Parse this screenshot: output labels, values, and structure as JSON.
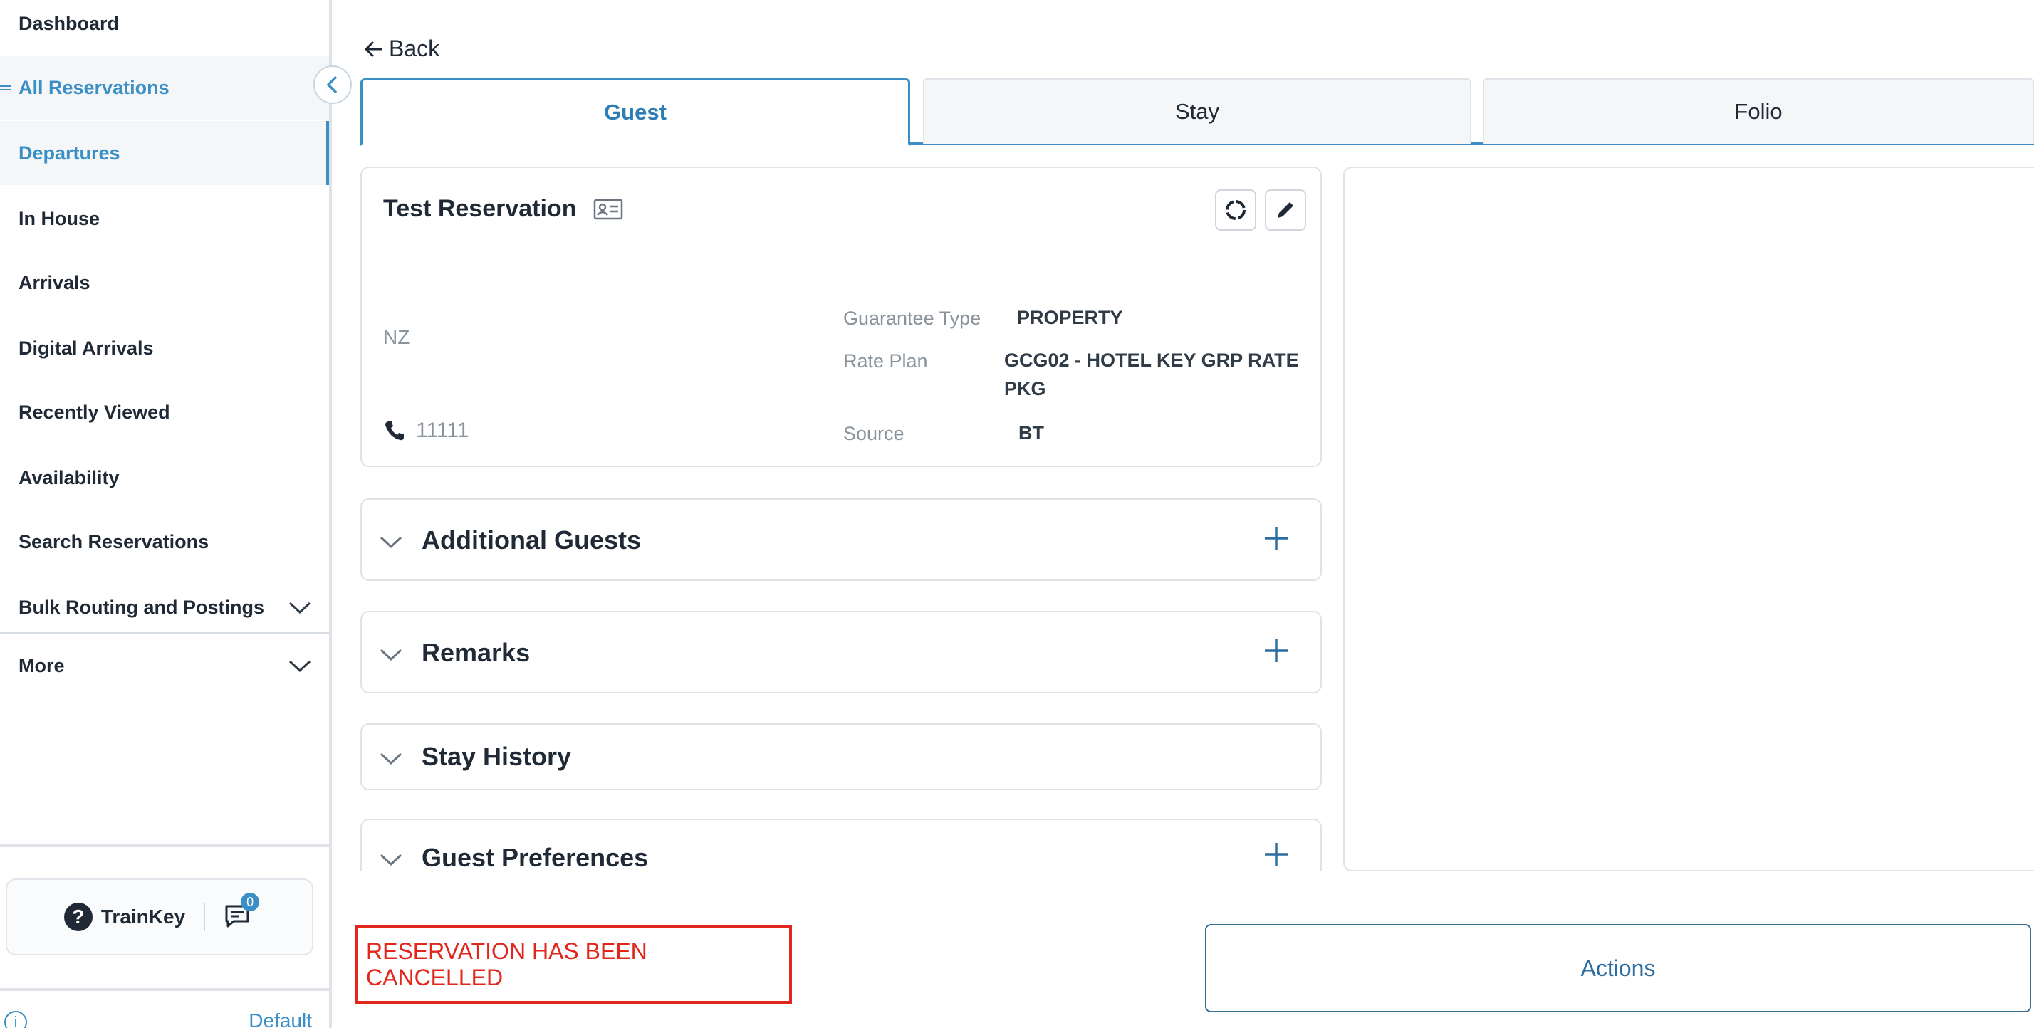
{
  "sidebar": {
    "items": [
      {
        "label": "Dashboard"
      },
      {
        "label": "All Reservations"
      },
      {
        "label": "Departures"
      },
      {
        "label": "In House"
      },
      {
        "label": "Arrivals"
      },
      {
        "label": "Digital Arrivals"
      },
      {
        "label": "Recently Viewed"
      },
      {
        "label": "Availability"
      },
      {
        "label": "Search Reservations"
      },
      {
        "label": "Bulk Routing and Postings"
      },
      {
        "label": "More"
      }
    ],
    "trainkey_label": "TrainKey",
    "message_count": "0",
    "default_label": "Default"
  },
  "header": {
    "back_label": "Back"
  },
  "tabs": [
    {
      "label": "Guest"
    },
    {
      "label": "Stay"
    },
    {
      "label": "Folio"
    }
  ],
  "guest": {
    "name": "Test Reservation",
    "country": "NZ",
    "phone": "11111",
    "fields": [
      {
        "label": "Guarantee Type",
        "value": "PROPERTY"
      },
      {
        "label": "Rate Plan",
        "value": "GCG02 - HOTEL KEY GRP RATE PKG"
      },
      {
        "label": "Source",
        "value": "BT"
      }
    ]
  },
  "sections": [
    {
      "title": "Additional Guests"
    },
    {
      "title": "Remarks"
    },
    {
      "title": "Stay History"
    },
    {
      "title": "Guest Preferences"
    }
  ],
  "footer": {
    "status_message": "RESERVATION HAS BEEN CANCELLED",
    "actions_label": "Actions"
  },
  "colors": {
    "accent": "#3b8fc4",
    "error": "#e2261c",
    "text": "#1f2a36",
    "muted": "#8a939c"
  }
}
